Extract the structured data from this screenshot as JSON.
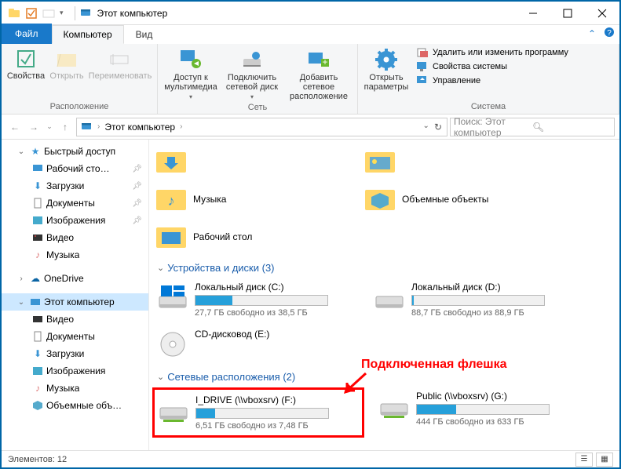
{
  "title": "Этот компьютер",
  "tabs": {
    "file": "Файл",
    "computer": "Компьютер",
    "view": "Вид"
  },
  "ribbon": {
    "location": {
      "props": "Свойства",
      "open": "Открыть",
      "rename": "Переименовать",
      "group": "Расположение"
    },
    "network": {
      "media": "Доступ к мультимедиа",
      "map": "Подключить сетевой диск",
      "addnet": "Добавить сетевое расположение",
      "group": "Сеть"
    },
    "system": {
      "openparams": "Открыть параметры",
      "uninstall": "Удалить или изменить программу",
      "sysprops": "Свойства системы",
      "manage": "Управление",
      "group": "Система"
    }
  },
  "breadcrumb": {
    "loc": "Этот компьютер"
  },
  "search": {
    "placeholder": "Поиск: Этот компьютер"
  },
  "sidebar": {
    "quick": "Быстрый доступ",
    "desktop": "Рабочий сто…",
    "downloads": "Загрузки",
    "documents": "Документы",
    "pictures": "Изображения",
    "videos": "Видео",
    "music": "Музыка",
    "onedrive": "OneDrive",
    "thispc": "Этот компьютер",
    "pc_videos": "Видео",
    "pc_documents": "Документы",
    "pc_downloads": "Загрузки",
    "pc_pictures": "Изображения",
    "pc_music": "Музыка",
    "pc_3d": "Объемные объ…"
  },
  "folders": {
    "music": "Музыка",
    "objects3d": "Объемные объекты",
    "desktop": "Рабочий стол"
  },
  "groups": {
    "devices": "Устройства и диски (3)",
    "network": "Сетевые расположения (2)"
  },
  "drives": {
    "c": {
      "name": "Локальный диск (C:)",
      "status": "27,7 ГБ свободно из 38,5 ГБ",
      "fill": 28
    },
    "d": {
      "name": "Локальный диск (D:)",
      "status": "88,7 ГБ свободно из 88,9 ГБ",
      "fill": 1
    },
    "e": {
      "name": "CD-дисковод (E:)"
    },
    "f": {
      "name": "I_DRIVE (\\\\vboxsrv) (F:)",
      "status": "6,51 ГБ свободно из 7,48 ГБ",
      "fill": 14
    },
    "g": {
      "name": "Public (\\\\vboxsrv) (G:)",
      "status": "444 ГБ свободно из 633 ГБ",
      "fill": 30
    }
  },
  "annotation": "Подключенная флешка",
  "status": {
    "items": "Элементов: 12"
  }
}
